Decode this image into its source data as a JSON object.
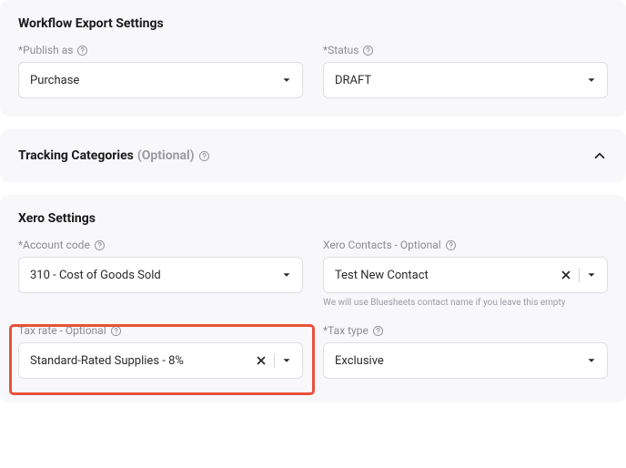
{
  "workflow": {
    "title": "Workflow Export Settings",
    "publish_as": {
      "label": "*Publish as",
      "value": "Purchase"
    },
    "status": {
      "label": "*Status",
      "value": "DRAFT"
    }
  },
  "tracking": {
    "title": "Tracking Categories",
    "optional_label": "(Optional)"
  },
  "xero": {
    "title": "Xero Settings",
    "account_code": {
      "label": "*Account code",
      "value": "310 - Cost of Goods Sold"
    },
    "contacts": {
      "label": "Xero Contacts - Optional",
      "value": "Test New Contact",
      "hint": "We will use Bluesheets contact name if you leave this empty"
    },
    "tax_rate": {
      "label": "Tax rate - Optional",
      "value": "Standard-Rated Supplies - 8%"
    },
    "tax_type": {
      "label": "*Tax type",
      "value": "Exclusive"
    }
  }
}
